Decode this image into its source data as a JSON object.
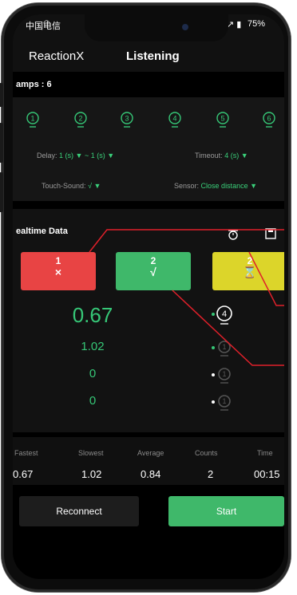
{
  "status": {
    "carrier": "中国电信",
    "battery": "75%"
  },
  "header": {
    "app_name": "ReactionX",
    "state": "Listening"
  },
  "lamps": {
    "label": "amps : 6",
    "items": [
      "1",
      "2",
      "3",
      "4",
      "5",
      "6"
    ]
  },
  "config": {
    "delay_label": "Delay:",
    "delay_value": "1 (s) ▼ ~ 1 (s) ▼",
    "timeout_label": "Timeout:",
    "timeout_value": "4 (s) ▼",
    "touch_label": "Touch-Sound:",
    "touch_value": "√ ▼",
    "sensor_label": "Sensor:",
    "sensor_value": "Close distance ▼"
  },
  "realtime": {
    "label": "ealtime Data",
    "tiles": [
      {
        "num": "1",
        "sym": "×",
        "color": "#e84444"
      },
      {
        "num": "2",
        "sym": "√",
        "color": "#3fb86a"
      },
      {
        "num": "2",
        "sym": "⌛",
        "color": "#dcd52a"
      }
    ],
    "values": [
      "0.67",
      "1.02",
      "0",
      "0"
    ],
    "lamp_nums": [
      "4",
      "1",
      "1",
      "1"
    ]
  },
  "stats": {
    "headers": [
      "Fastest",
      "Slowest",
      "Average",
      "Counts",
      "Time"
    ],
    "values": [
      "0.67",
      "1.02",
      "0.84",
      "2",
      "00:15"
    ]
  },
  "buttons": {
    "reconnect": "Reconnect",
    "start": "Start"
  }
}
